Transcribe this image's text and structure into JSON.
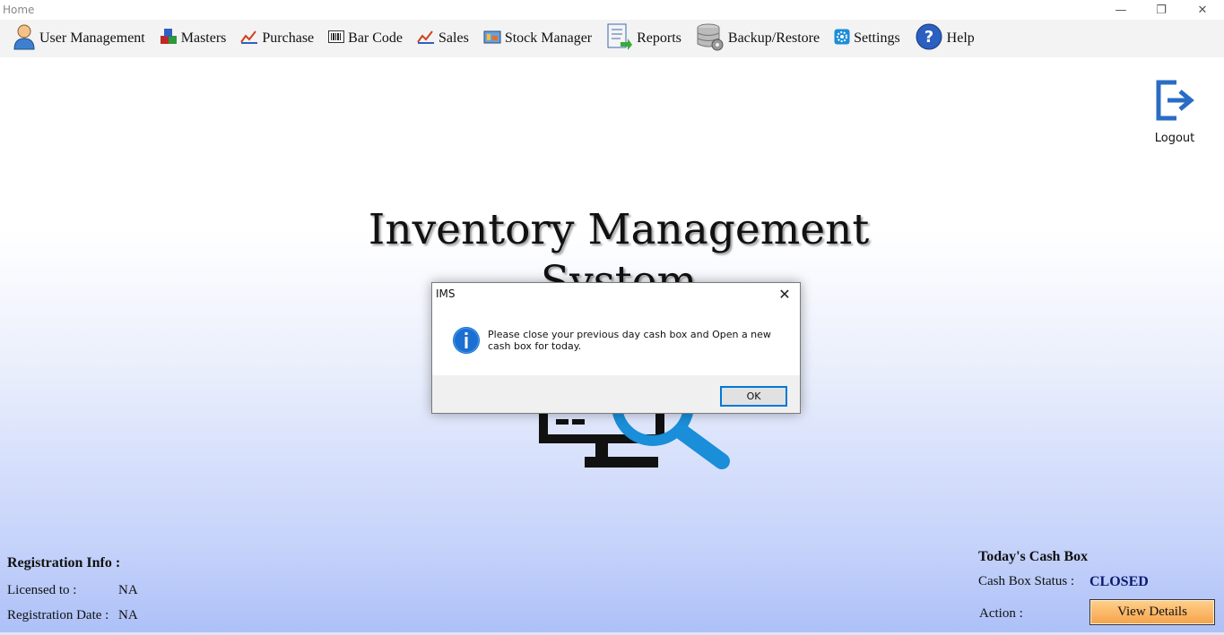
{
  "window": {
    "title": "Home",
    "controls": {
      "minimize": "—",
      "restore": "❐",
      "close": "✕"
    }
  },
  "menu": {
    "items": [
      {
        "label": "User Management",
        "icon": "user-icon"
      },
      {
        "label": "Masters",
        "icon": "blocks-icon"
      },
      {
        "label": "Purchase",
        "icon": "purchase-icon"
      },
      {
        "label": "Bar Code",
        "icon": "barcode-icon"
      },
      {
        "label": "Sales",
        "icon": "sales-icon"
      },
      {
        "label": "Stock Manager",
        "icon": "stock-icon"
      },
      {
        "label": "Reports",
        "icon": "reports-icon"
      },
      {
        "label": "Backup/Restore",
        "icon": "database-icon"
      },
      {
        "label": "Settings",
        "icon": "gear-icon"
      },
      {
        "label": "Help",
        "icon": "help-icon"
      }
    ]
  },
  "logout": {
    "label": "Logout",
    "icon": "logout-icon"
  },
  "app_title": {
    "line1": "Inventory Management",
    "line2": "System"
  },
  "registration": {
    "header": "Registration Info :",
    "licensed_label": "Licensed to :",
    "licensed_value": "NA",
    "date_label": "Registration Date :",
    "date_value": "NA"
  },
  "cashbox": {
    "header": "Today's Cash Box",
    "status_label": "Cash Box Status :",
    "status_value": "CLOSED",
    "action_label": "Action :",
    "button_label": "View Details"
  },
  "dialog": {
    "title": "IMS",
    "message": "Please close your previous day cash box and Open a new cash box for today.",
    "ok_label": "OK",
    "icon": "info-icon",
    "close_glyph": "✕"
  },
  "colors": {
    "accent_blue": "#2b6cc4",
    "status_text": "#0a1a70",
    "button_orange": "#f7a24a",
    "dialog_focus": "#0078d7"
  }
}
